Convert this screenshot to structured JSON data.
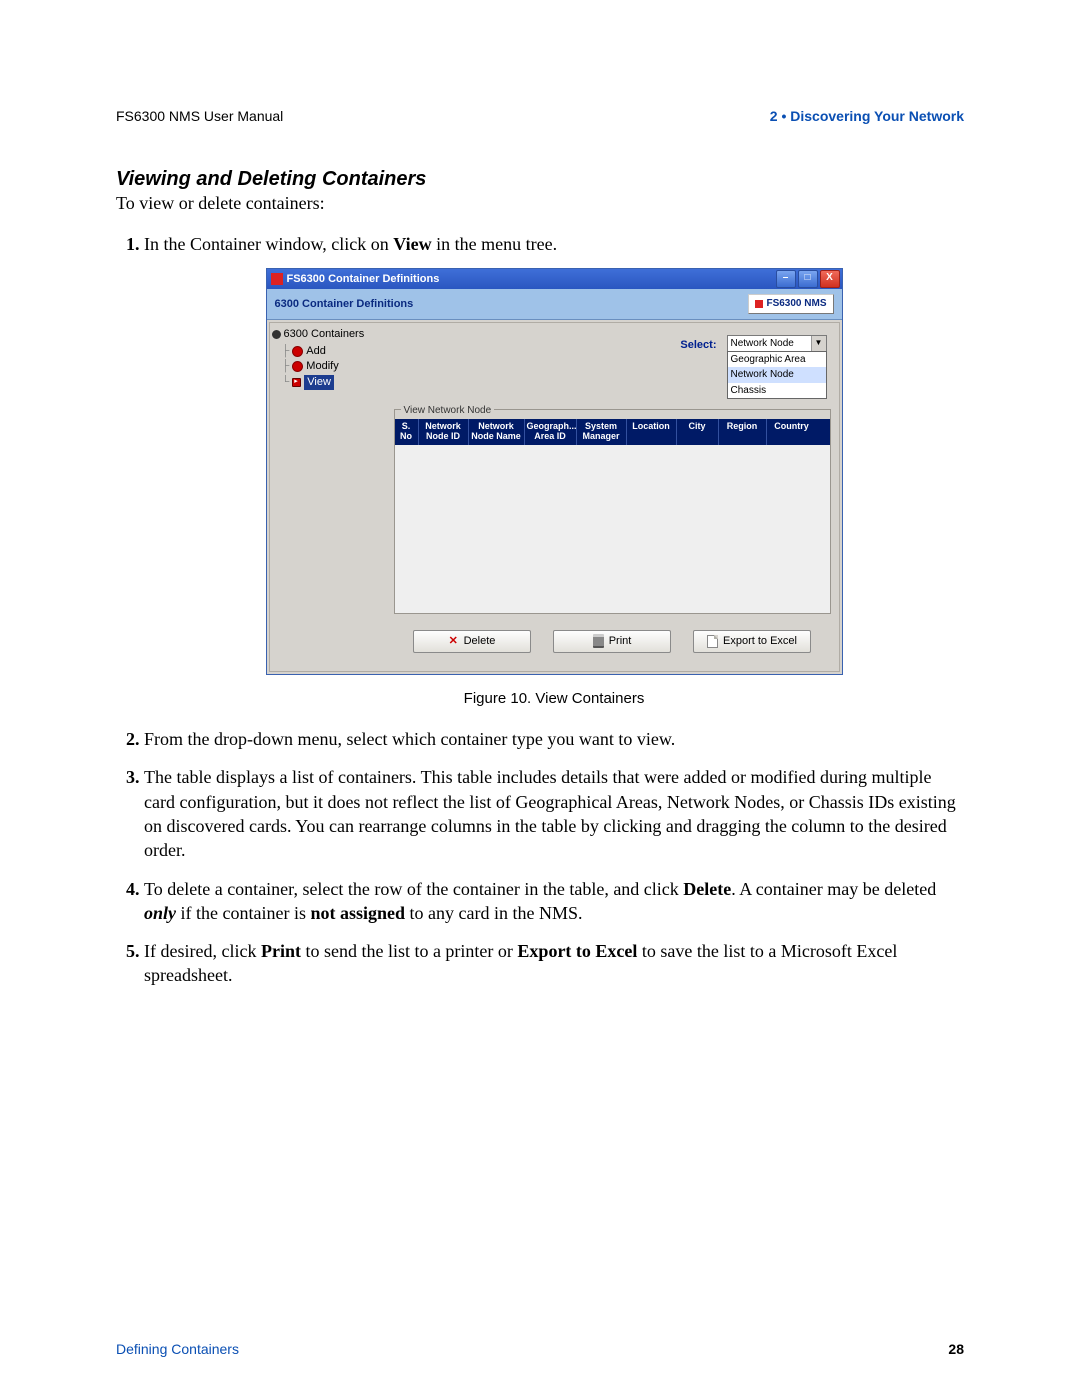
{
  "header": {
    "left": "FS6300 NMS User Manual",
    "right": "2 • Discovering Your Network"
  },
  "section_title": "Viewing and Deleting Containers",
  "intro": "To view or delete containers:",
  "steps": {
    "s1_pre": "In the Container window, click on ",
    "s1_b": "View",
    "s1_post": " in the menu tree.",
    "s2": "From the drop-down menu, select which container type you want to view.",
    "s3": "The table displays a list of containers. This table includes details that were added or modified during multiple card configuration, but it does not reflect the list of Geographical Areas, Network Nodes, or Chassis IDs existing on discovered cards. You can rearrange columns in the table by clicking and dragging the column to the desired order.",
    "s4_pre": "To delete a container, select the row of the container in the table, and click ",
    "s4_b1": "Delete",
    "s4_mid": ". A container may be deleted ",
    "s4_em": "only",
    "s4_mid2": " if the container is ",
    "s4_b2": "not assigned",
    "s4_post": " to any card in the NMS.",
    "s5_pre": "If desired, click ",
    "s5_b1": "Print",
    "s5_mid1": " to send the list to a printer or ",
    "s5_b2": "Export to Excel",
    "s5_post": " to save the list to a Microsoft Excel spreadsheet."
  },
  "figure_caption": "Figure 10. View Containers",
  "app": {
    "title": "FS6300 Container Definitions",
    "subheader": "6300 Container Definitions",
    "brand": "FS6300 NMS",
    "tree": {
      "root": "6300 Containers",
      "items": [
        "Add",
        "Modify",
        "View"
      ],
      "selected": "View"
    },
    "select_label": "Select:",
    "select_value": "Network Node",
    "select_options": [
      "Geographic Area",
      "Network Node",
      "Chassis"
    ],
    "fieldset_legend": "View Network Node",
    "columns": [
      "S. No",
      "Network Node ID",
      "Network Node Name",
      "Geograph... Area ID",
      "System Manager",
      "Location",
      "City",
      "Region",
      "Country"
    ],
    "buttons": {
      "delete": "Delete",
      "print": "Print",
      "export": "Export to Excel"
    },
    "win_controls": {
      "min": "–",
      "max": "□",
      "close": "X"
    }
  },
  "footer": {
    "left": "Defining Containers",
    "page": "28"
  }
}
